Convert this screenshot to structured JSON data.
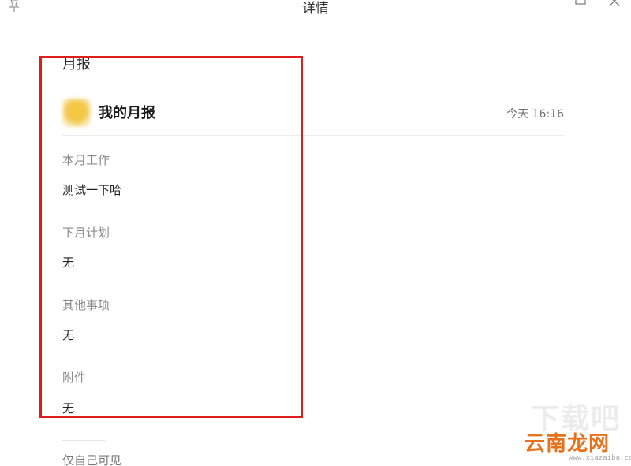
{
  "window": {
    "title": "详情",
    "icons": [
      "pin-icon",
      "maximize-icon",
      "close-icon"
    ]
  },
  "report": {
    "type_label": "月报",
    "title": "我的月报",
    "timestamp": "今天 16:16",
    "sections": [
      {
        "label": "本月工作",
        "value": "测试一下哈"
      },
      {
        "label": "下月计划",
        "value": "无"
      },
      {
        "label": "其他事项",
        "value": "无"
      },
      {
        "label": "附件",
        "value": "无"
      }
    ],
    "visibility": "仅自己可见"
  },
  "colors": {
    "highlight": "#e01d1d",
    "avatar": "#f3c74a",
    "watermark": "#e8721c"
  },
  "watermark": {
    "top": "下载吧",
    "main": "云南龙网",
    "sub": "www.xiazaiba.com"
  }
}
